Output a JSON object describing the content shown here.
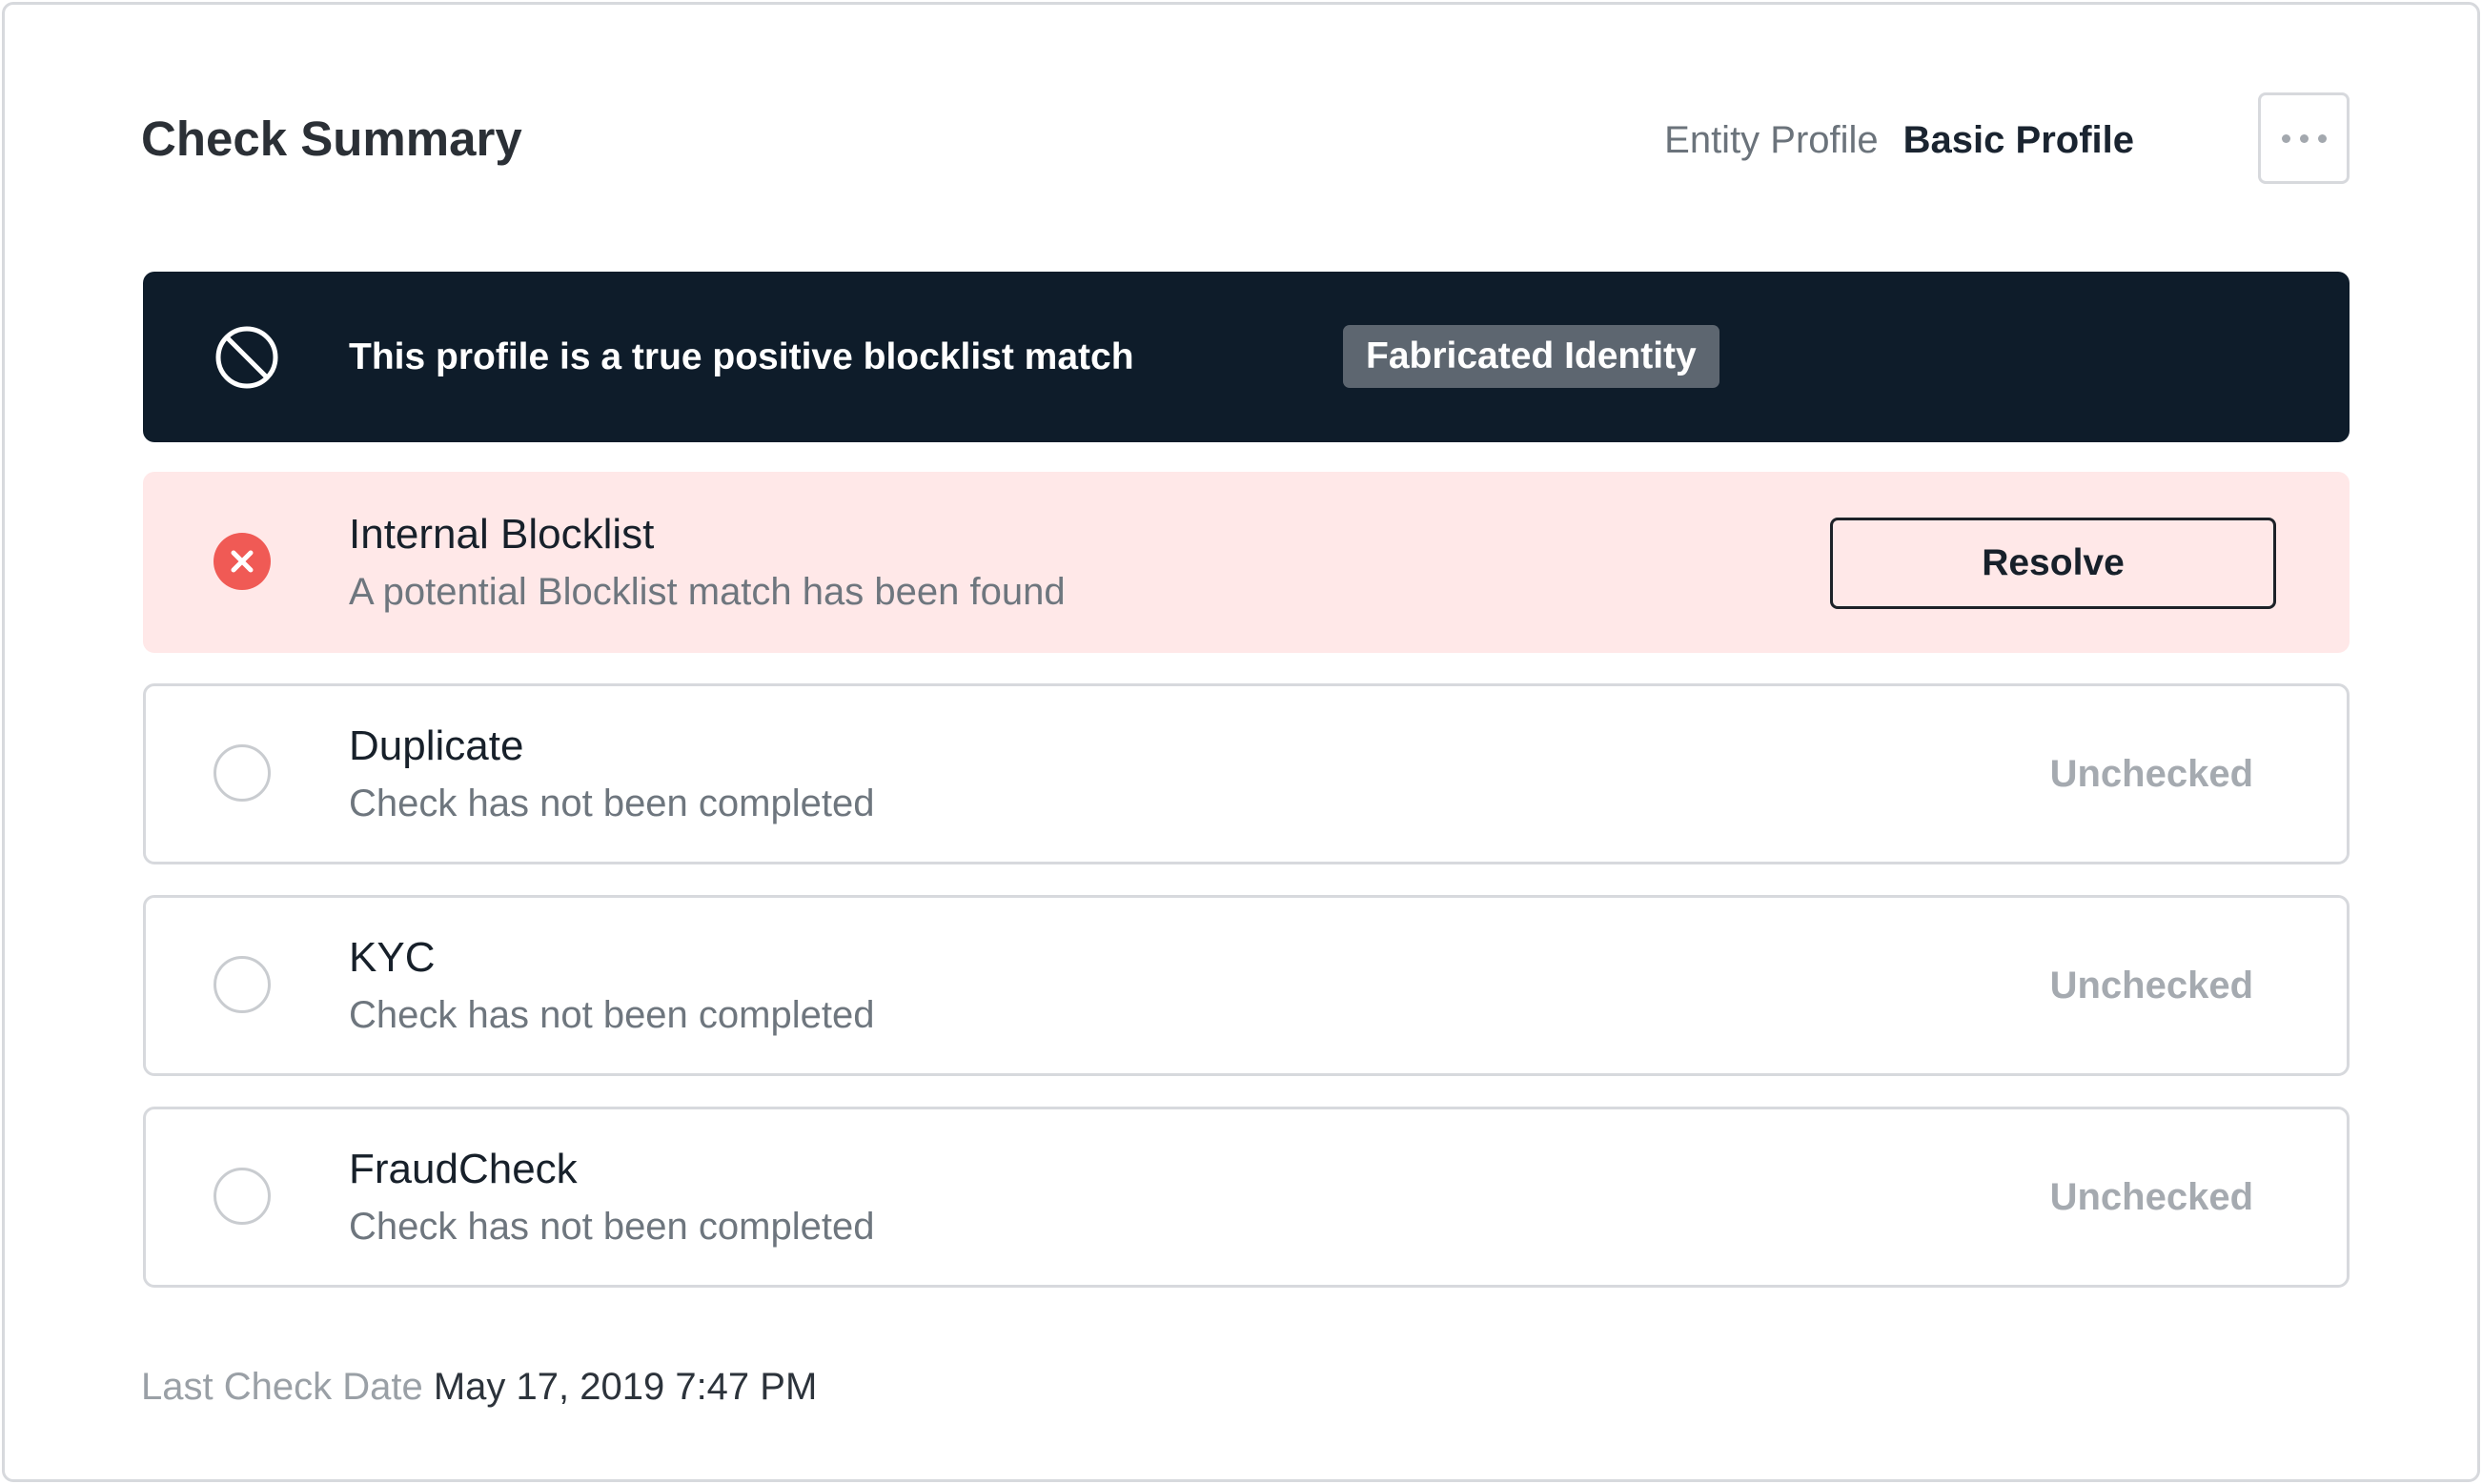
{
  "header": {
    "title": "Check Summary",
    "tab_entity": "Entity Profile",
    "tab_basic": "Basic Profile",
    "more_icon": "more-horizontal-icon"
  },
  "banner": {
    "icon": "blocked-icon",
    "message": "This profile is a true positive blocklist match",
    "tag": "Fabricated Identity"
  },
  "checks": [
    {
      "name": "Internal Blocklist",
      "description": "A potential Blocklist match has been found",
      "status_icon": "error-circle-icon",
      "action_label": "Resolve"
    },
    {
      "name": "Duplicate",
      "description": "Check has not been completed",
      "status_icon": "empty-circle-icon",
      "state": "Unchecked"
    },
    {
      "name": "KYC",
      "description": "Check has not been completed",
      "status_icon": "empty-circle-icon",
      "state": "Unchecked"
    },
    {
      "name": "FraudCheck",
      "description": "Check has not been completed",
      "status_icon": "empty-circle-icon",
      "state": "Unchecked"
    }
  ],
  "footer": {
    "label": "Last Check Date",
    "value": "May 17, 2019 7:47 PM"
  },
  "colors": {
    "banner_bg": "#0e1c2a",
    "alert_bg": "#ffe8e8",
    "error_red": "#f05a55",
    "tag_bg": "#5d6670",
    "muted_text": "#a5aab0"
  }
}
